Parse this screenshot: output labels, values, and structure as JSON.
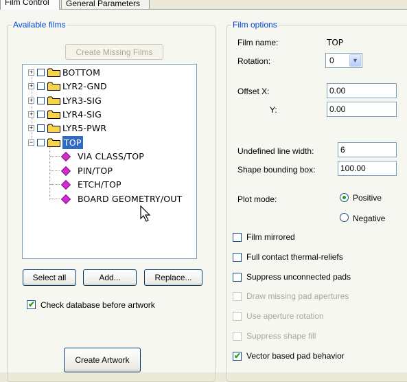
{
  "tabs": [
    {
      "label": "Film Control"
    },
    {
      "label": "General Parameters"
    }
  ],
  "available_films": {
    "legend": "Available films",
    "create_missing_label": "Create Missing Films",
    "tree": {
      "films": [
        "BOTTOM",
        "LYR2-GND",
        "LYR3-SIG",
        "LYR4-SIG",
        "LYR5-PWR",
        "TOP"
      ],
      "selected": "TOP",
      "children": [
        "VIA CLASS/TOP",
        "PIN/TOP",
        "ETCH/TOP",
        "BOARD GEOMETRY/OUT"
      ]
    },
    "select_all_label": "Select all",
    "add_label": "Add...",
    "replace_label": "Replace...",
    "check_db_label": "Check database before artwork",
    "check_db_checked": true,
    "create_artwork_label": "Create Artwork"
  },
  "film_options": {
    "legend": "Film options",
    "film_name_label": "Film name:",
    "film_name_value": "TOP",
    "rotation_label": "Rotation:",
    "rotation_value": "0",
    "offset_x_label": "Offset  X:",
    "offset_x_value": "0.00",
    "offset_y_label": "Y:",
    "offset_y_value": "0.00",
    "undef_line_width_label": "Undefined line width:",
    "undef_line_width_value": "6",
    "shape_bbox_label": "Shape bounding box:",
    "shape_bbox_value": "100.00",
    "plot_mode_label": "Plot mode:",
    "positive_label": "Positive",
    "negative_label": "Negative",
    "plot_mode_value": "Positive",
    "checkboxes": [
      {
        "label": "Film mirrored",
        "checked": false,
        "enabled": true
      },
      {
        "label": "Full contact thermal-reliefs",
        "checked": false,
        "enabled": true
      },
      {
        "label": "Suppress unconnected pads",
        "checked": false,
        "enabled": true
      },
      {
        "label": "Draw missing pad apertures",
        "checked": false,
        "enabled": false
      },
      {
        "label": "Use aperture rotation",
        "checked": false,
        "enabled": false
      },
      {
        "label": "Suppress shape fill",
        "checked": false,
        "enabled": false
      },
      {
        "label": "Vector based pad behavior",
        "checked": true,
        "enabled": true
      }
    ]
  },
  "colors": {
    "selection": "#316ac5",
    "legend": "#0046d5",
    "check": "#21a121",
    "folder": "#f7d34a"
  }
}
